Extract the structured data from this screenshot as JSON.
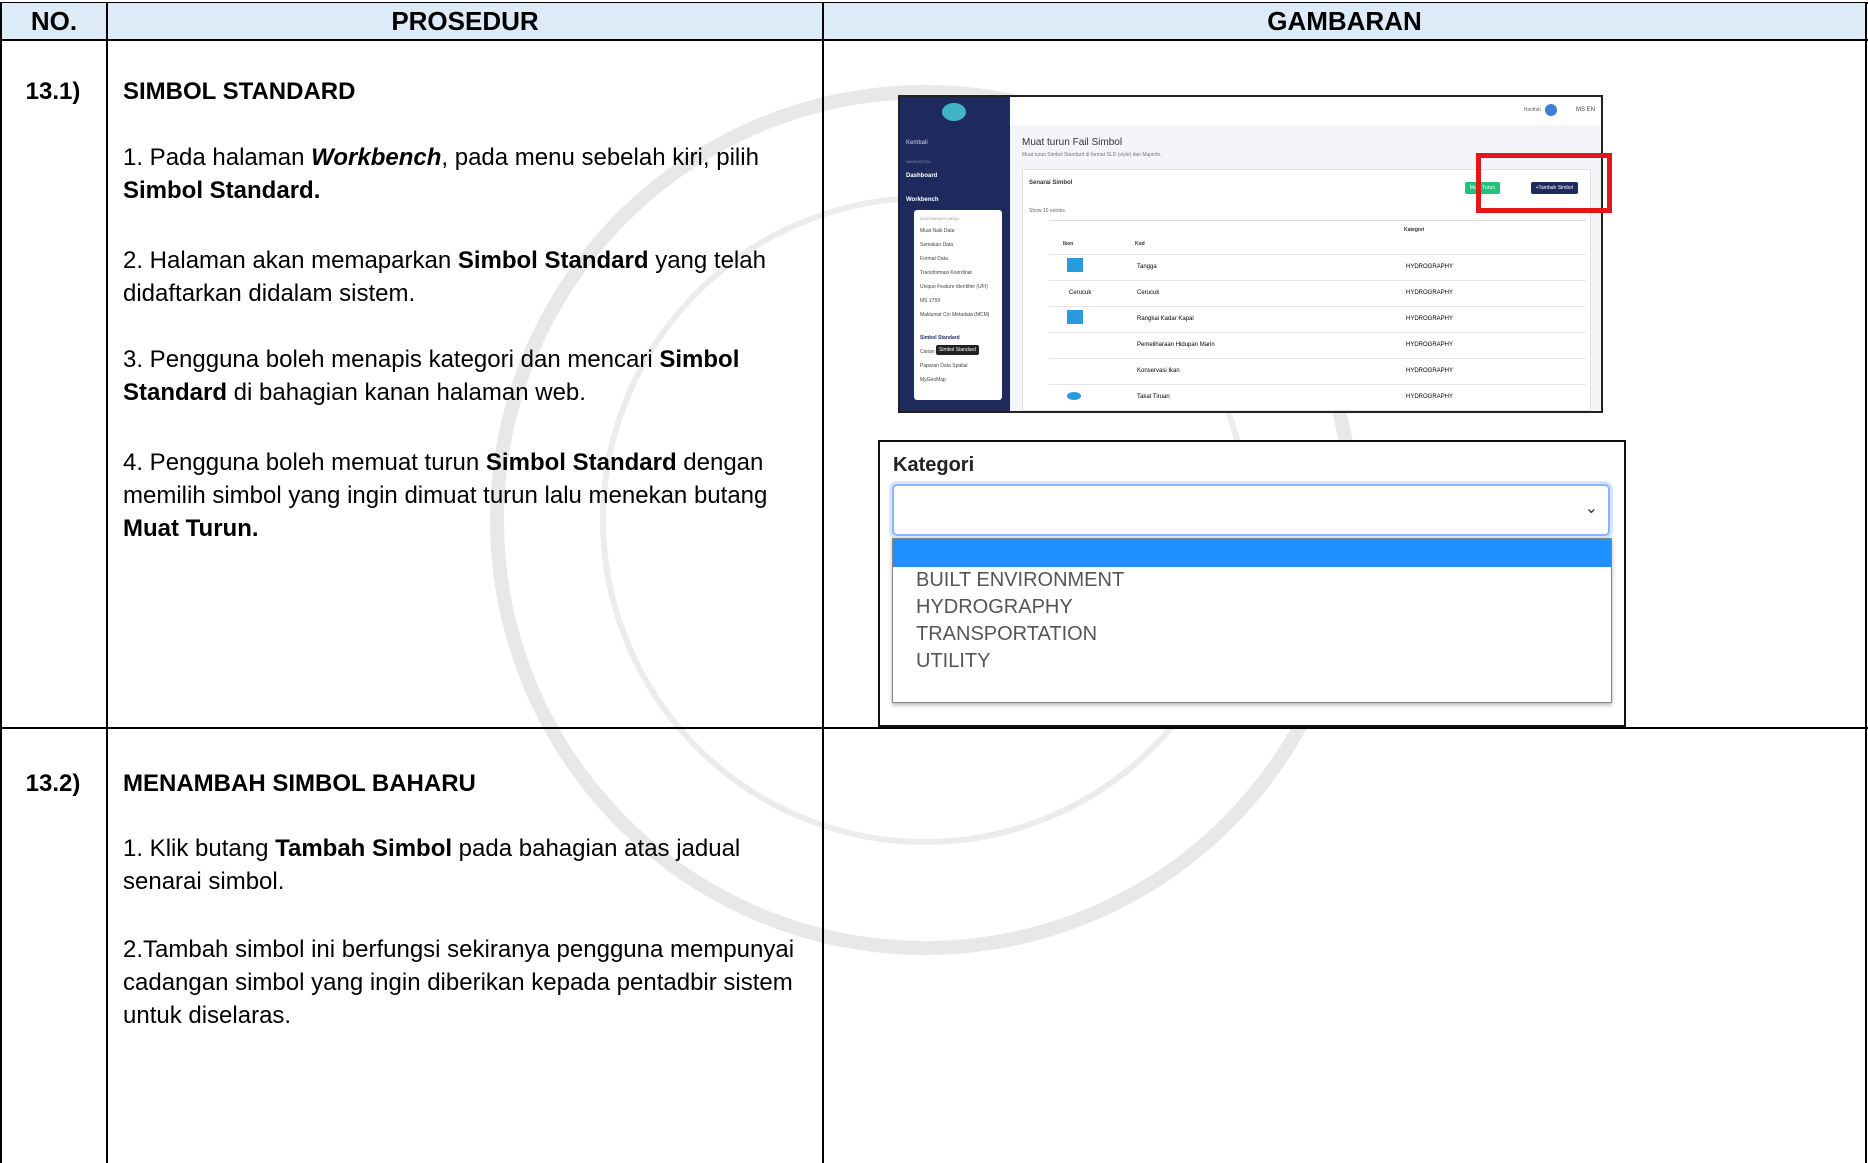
{
  "table": {
    "headers": {
      "no": "NO.",
      "prosedur": "PROSEDUR",
      "gambaran": "GAMBARAN"
    },
    "header_bg": "#dcebf7"
  },
  "sections": [
    {
      "no": "13.1)",
      "title": "SIMBOL STANDARD",
      "steps": [
        {
          "parts": [
            "1. Pada halaman ",
            "Workbench",
            ", pada menu sebelah kiri, pilih ",
            "Simbol Standard."
          ]
        },
        {
          "parts": [
            "2. Halaman akan memaparkan ",
            "Simbol Standard",
            " yang telah didaftarkan didalam sistem."
          ]
        },
        {
          "parts": [
            "3. Pengguna boleh menapis kategori dan mencari ",
            "Simbol Standard",
            " di bahagian kanan halaman web."
          ]
        },
        {
          "parts": [
            "4. Pengguna boleh memuat turun ",
            "Simbol Standard",
            " dengan memilih simbol yang ingin dimuat turun lalu menekan butang ",
            "Muat Turun."
          ]
        }
      ]
    },
    {
      "no": "13.2)",
      "title": "MENAMBAH SIMBOL BAHARU",
      "steps": [
        {
          "parts": [
            "1. Klik butang ",
            "Tambah Simbol",
            " pada bahagian atas jadual senarai simbol."
          ]
        },
        {
          "parts": [
            "2.Tambah simbol ini berfungsi sekiranya pengguna mempunyai cadangan simbol yang ingin diberikan kepada pentadbir sistem untuk diselaras."
          ]
        }
      ]
    }
  ],
  "screenshot1": {
    "topbar_user": "Hanifah",
    "lang": "MS EN",
    "sidebar": {
      "back": "Kembali",
      "section_label": "NAVIGATION",
      "dashboard": "Dashboard",
      "workbench": "Workbench",
      "submenu_header": "WORKBENCH MENU",
      "submenu": [
        "Muat Naik Data",
        "Semakan Data",
        "Format Data",
        "Transformasi Koordinat",
        "Unique Feature Identifier (UFI)",
        "MS 1759",
        "Maklumat Ciri Metadata (MCM)",
        "Simbol Standard",
        "Carian",
        "Paparan Data Spatial",
        "MyGeoMap"
      ],
      "tooltip": "Simbol Standard"
    },
    "page_title": "Muat turun Fail Simbol",
    "page_subtitle": "Muat turun Simbol Standard di format SLD (style) dan Mapinfo.",
    "card_title": "Senarai Simbol",
    "btn_download": "Muat Turun",
    "btn_add": "+Tambah Simbol",
    "show_entries": "Show 10 entries",
    "search_label": "Search:",
    "columns": [
      "Ikon",
      "Kod",
      "Kategori"
    ],
    "rows": [
      {
        "kod": "Tangga",
        "kategori": "HYDROGRAPHY"
      },
      {
        "kod": "Cerucuk",
        "kategori": "HYDROGRAPHY",
        "icon_text": "Cerucuk"
      },
      {
        "kod": "Rangkai Kadar Kapal",
        "kategori": "HYDROGRAPHY"
      },
      {
        "kod": "Pemeliharaan Hidupan Marin",
        "kategori": "HYDROGRAPHY"
      },
      {
        "kod": "Konservasi Ikan",
        "kategori": "HYDROGRAPHY"
      },
      {
        "kod": "Takat Tiruan",
        "kategori": "HYDROGRAPHY"
      }
    ],
    "accent_green": "#21c27a",
    "accent_navy": "#1e2a5e",
    "highlight_red": "#e3171b"
  },
  "screenshot2": {
    "label": "Kategori",
    "options": [
      "BUILT ENVIRONMENT",
      "HYDROGRAPHY",
      "TRANSPORTATION",
      "UTILITY"
    ],
    "selected_color": "#1e90ff"
  }
}
